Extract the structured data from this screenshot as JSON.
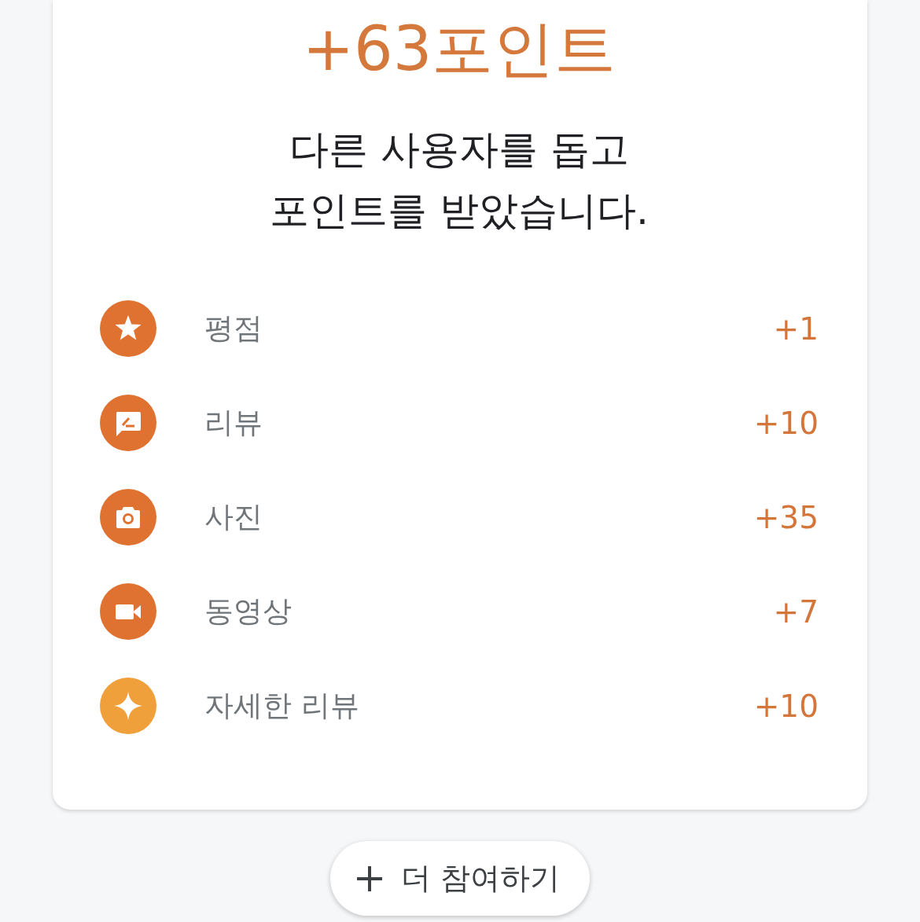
{
  "title": "+63포인트",
  "message_lines": [
    "다른 사용자를 돕고",
    "포인트를 받았습니다."
  ],
  "items": [
    {
      "kind": "star",
      "label": "평점",
      "points": "+1",
      "color": "#df7230"
    },
    {
      "kind": "review",
      "label": "리뷰",
      "points": "+10",
      "color": "#df7230"
    },
    {
      "kind": "photo",
      "label": "사진",
      "points": "+35",
      "color": "#df7230"
    },
    {
      "kind": "video",
      "label": "동영상",
      "points": "+7",
      "color": "#df7230"
    },
    {
      "kind": "sparkle",
      "label": "자세한 리뷰",
      "points": "+10",
      "color": "#f0a03a"
    }
  ],
  "button": {
    "label": "더 참여하기"
  }
}
